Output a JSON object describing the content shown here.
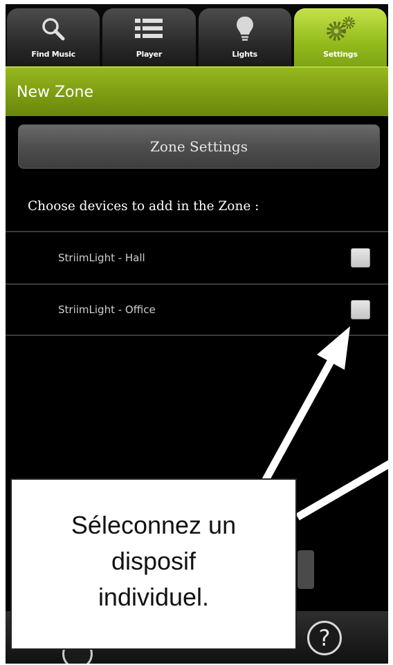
{
  "tabs": [
    {
      "label": "Find Music",
      "icon": "search-icon",
      "active": false
    },
    {
      "label": "Player",
      "icon": "list-icon",
      "active": false
    },
    {
      "label": "Lights",
      "icon": "lightbulb-icon",
      "active": false
    },
    {
      "label": "Settings",
      "icon": "gear-icon",
      "active": true
    }
  ],
  "header": {
    "title": "New Zone"
  },
  "zone_settings_label": "Zone Settings",
  "choose_label": "Choose devices to add in the Zone :",
  "devices": [
    {
      "label": "StriimLight - Hall",
      "checked": false
    },
    {
      "label": "StriimLight - Office",
      "checked": false
    }
  ],
  "help_icon": "help-icon",
  "annotation": {
    "text": "Séleconnez un\ndisposif\nindividuel."
  },
  "colors": {
    "accent": "#93bb1c",
    "header": "#7d9c12",
    "background": "#000000"
  }
}
